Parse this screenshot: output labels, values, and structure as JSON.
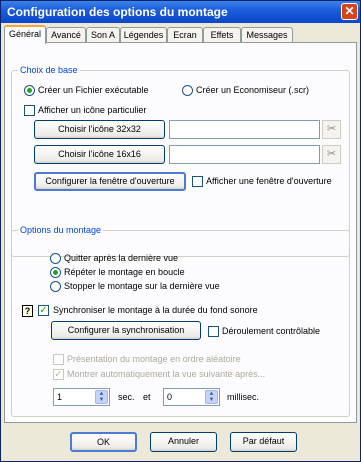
{
  "window": {
    "title": "Configuration des options du montage",
    "close_icon": "✕"
  },
  "tabs": [
    {
      "label": "Général"
    },
    {
      "label": "Avancé"
    },
    {
      "label": "Son A"
    },
    {
      "label": "Légendes"
    },
    {
      "label": "Ecran"
    },
    {
      "label": "Effets"
    },
    {
      "label": "Messages"
    }
  ],
  "base": {
    "legend": "Choix de base",
    "radio_exe": "Créer un Fichier exécutable",
    "radio_scr": "Créer un Economiseur (.scr)",
    "show_icon": "Afficher un icône particulier",
    "icon32_button": "Choisir l'icône 32x32",
    "icon16_button": "Choisir l'icône 16x16",
    "scissors_icon": "✂",
    "open_window_button": "Configurer la fenêtre d'ouverture",
    "show_open_window": "Afficher une fenêtre d'ouverture"
  },
  "options": {
    "legend": "Options du montage",
    "radio_quit": "Quitter après la dernière vue",
    "radio_repeat": "Répéter le montage en boucle",
    "radio_stop": "Stopper le montage sur la dernière vue",
    "help_icon": "?",
    "sync_check": "Synchroniser le montage à la durée du fond sonore",
    "sync_button": "Configurer la synchronisation",
    "controllable": "Déroulement contrôlable",
    "random_order": "Présentation du montage en ordre aléatoire",
    "auto_next": "Montrer automatiquement la vue suivante après...",
    "sec_value": "1",
    "sec_label": "sec.",
    "and_label": "et",
    "ms_value": "0",
    "ms_label": "millisec."
  },
  "footer": {
    "ok": "OK",
    "cancel": "Annuler",
    "default": "Par défaut"
  }
}
